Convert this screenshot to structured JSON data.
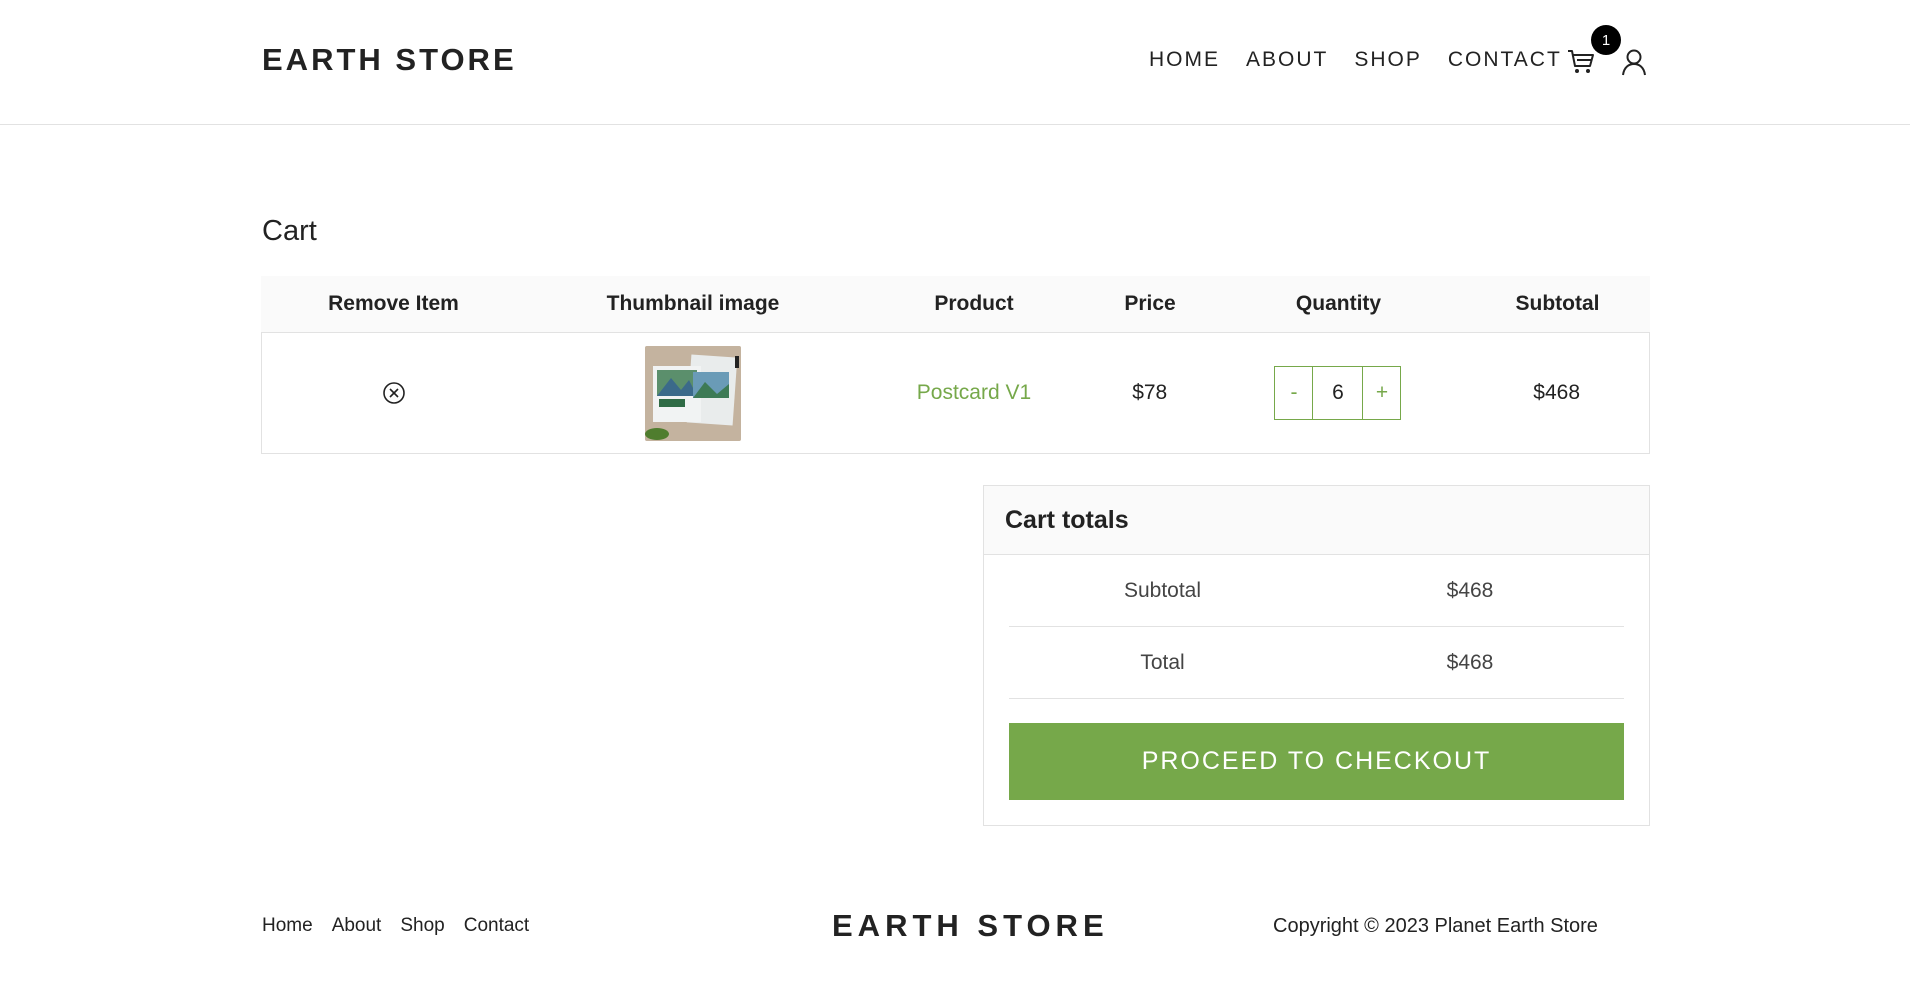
{
  "header": {
    "brand": "EARTH STORE",
    "nav": [
      "HOME",
      "ABOUT",
      "SHOP",
      "CONTACT"
    ],
    "cart_count": "1",
    "icons": [
      "cart-icon",
      "user-icon"
    ]
  },
  "cart": {
    "title": "Cart",
    "columns": [
      "Remove Item",
      "Thumbnail image",
      "Product",
      "Price",
      "Quantity",
      "Subtotal"
    ],
    "items": [
      {
        "product": "Postcard V1",
        "price": "$78",
        "quantity": "6",
        "subtotal": "$468",
        "minus": "-",
        "plus": "+"
      }
    ]
  },
  "totals": {
    "heading": "Cart totals",
    "subtotal_label": "Subtotal",
    "subtotal_value": "$468",
    "total_label": "Total",
    "total_value": "$468",
    "checkout_label": "PROCEED TO CHECKOUT"
  },
  "footer": {
    "links": [
      "Home",
      "About",
      "Shop",
      "Contact"
    ],
    "brand": "EARTH STORE",
    "copyright": "Copyright © 2023 Planet Earth Store"
  },
  "colors": {
    "accent": "#76a84a",
    "border": "#e2e2e2",
    "header_bg": "#fafafa"
  }
}
